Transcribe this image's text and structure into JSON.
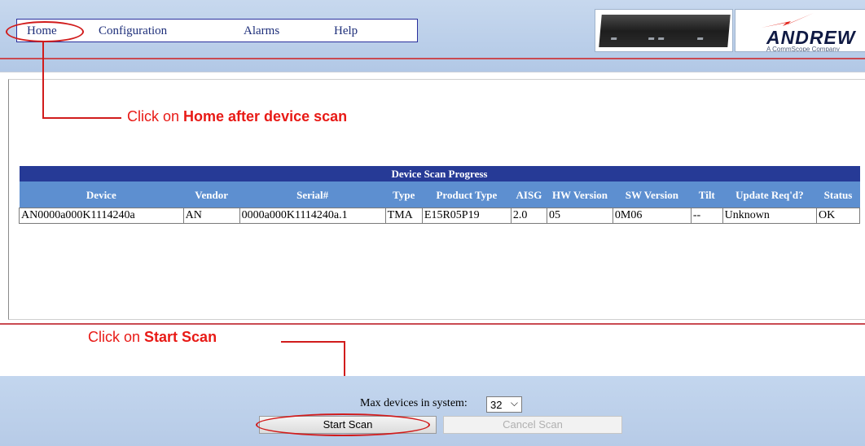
{
  "nav": {
    "items": [
      "Home",
      "Configuration",
      "Alarms",
      "Help"
    ]
  },
  "logo": {
    "name": "ANDREW",
    "tagline": "A CommScope Company"
  },
  "annotations": {
    "home_prefix": "Click on ",
    "home_bold": "Home after device scan",
    "scan_prefix": "Click on ",
    "scan_bold": "Start Scan"
  },
  "table": {
    "title": "Device Scan Progress",
    "headers": [
      "Device",
      "Vendor",
      "Serial#",
      "Type",
      "Product Type",
      "AISG",
      "HW Version",
      "SW Version",
      "Tilt",
      "Update Req'd?",
      "Status"
    ],
    "rows": [
      [
        "AN0000a000K1114240a",
        "AN",
        "0000a000K1114240a.1",
        "TMA",
        "E15R05P19",
        "2.0",
        "05",
        "0M06",
        "--",
        "Unknown",
        "OK"
      ]
    ]
  },
  "footer": {
    "max_label": "Max devices in system:",
    "max_value": "32",
    "start_label": "Start Scan",
    "cancel_label": "Cancel Scan"
  },
  "colors": {
    "annotation": "#e81a16",
    "table_title_bg": "#263a96",
    "table_header_bg": "#5d8fd0"
  }
}
